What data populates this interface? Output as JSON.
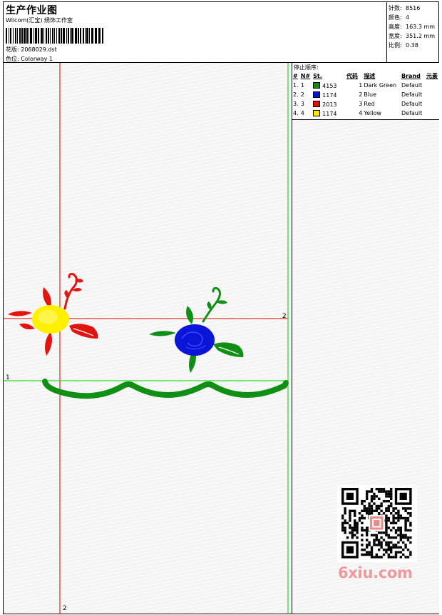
{
  "header": {
    "title": "生产作业图",
    "subtitle": "Wilcom(汇宝) 绣饰工作室",
    "design_label": "花版:",
    "design_value": "2068029.dst",
    "colorway_label": "色位:",
    "colorway_value": "Colorway 1"
  },
  "stats": [
    {
      "label": "针数:",
      "value": "8516"
    },
    {
      "label": "颜色:",
      "value": "4"
    },
    {
      "label": "高度:",
      "value": "163.3 mm"
    },
    {
      "label": "宽度:",
      "value": "351.2 mm"
    },
    {
      "label": "比例:",
      "value": "0.38"
    }
  ],
  "stop_sequence": {
    "title": "停止顺序:",
    "headers": [
      "#",
      "N#",
      "St.",
      "代码",
      "描述",
      "Brand",
      "元素"
    ],
    "rows": [
      {
        "index": "1.",
        "n": "1",
        "color": "#138a13",
        "st": "4153",
        "code": "1",
        "desc": "Dark Green",
        "brand": "Default"
      },
      {
        "index": "2.",
        "n": "2",
        "color": "#0a14d6",
        "st": "1174",
        "code": "2",
        "desc": "Blue",
        "brand": "Default"
      },
      {
        "index": "3.",
        "n": "3",
        "color": "#e0120c",
        "st": "2013",
        "code": "3",
        "desc": "Red",
        "brand": "Default"
      },
      {
        "index": "4.",
        "n": "4",
        "color": "#ffe800",
        "st": "1174",
        "code": "4",
        "desc": "Yellow",
        "brand": "Default"
      }
    ]
  },
  "guides": {
    "label_bottom": "2",
    "label_right": "2",
    "label_left": "1"
  },
  "colors": {
    "guide_red": "#e00000",
    "guide_green": "#00d000",
    "stitch_green": "#0f8f14",
    "stitch_blue": "#0b15d8",
    "stitch_red": "#e2140d",
    "stitch_yellow": "#ffef00"
  },
  "watermark": {
    "site": "6xiu.com"
  }
}
